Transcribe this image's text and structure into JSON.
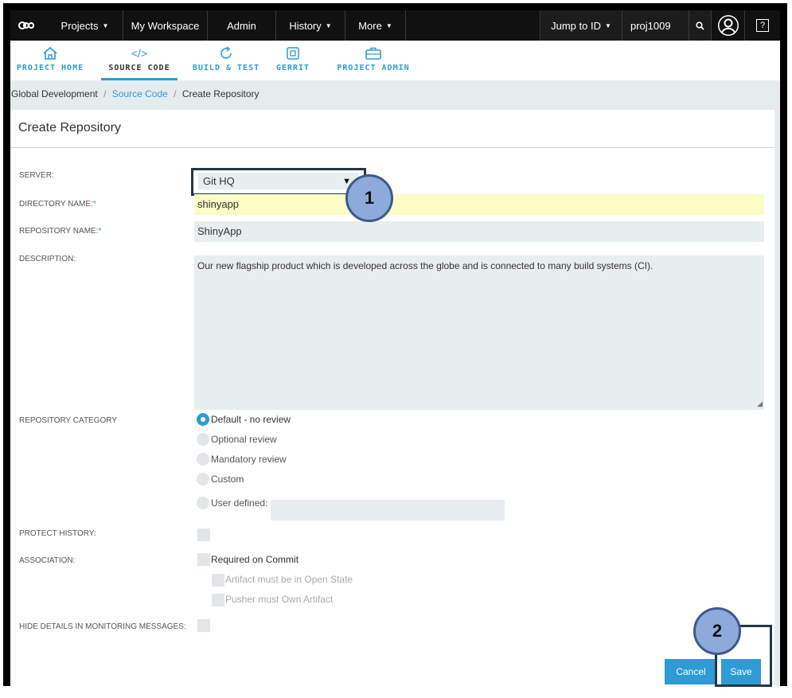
{
  "topnav": {
    "projects": "Projects",
    "workspace": "My Workspace",
    "admin": "Admin",
    "history": "History",
    "more": "More",
    "jump": "Jump to ID",
    "project_id": "proj1009",
    "help": "?"
  },
  "subnav": {
    "tabs": [
      {
        "label": "PROJECT HOME",
        "icon": "home-icon"
      },
      {
        "label": "SOURCE CODE",
        "icon": "code-icon",
        "active": true
      },
      {
        "label": "BUILD & TEST",
        "icon": "refresh-icon"
      },
      {
        "label": "GERRIT",
        "icon": "gerrit-icon"
      },
      {
        "label": "PROJECT ADMIN",
        "icon": "briefcase-icon"
      }
    ]
  },
  "breadcrumb": {
    "root": "Global Development",
    "section": "Source Code",
    "current": "Create Repository",
    "sep": "/"
  },
  "form": {
    "title": "Create Repository",
    "server_label": "SERVER:",
    "server_value": "Git HQ",
    "directory_label": "DIRECTORY NAME:",
    "directory_value": "shinyapp",
    "repo_label": "REPOSITORY NAME:",
    "repo_value": "ShinyApp",
    "description_label": "DESCRIPTION:",
    "description_value": "Our new flagship product which is developed across the globe and is connected to many build systems (CI).",
    "category_label": "REPOSITORY CATEGORY",
    "categories": [
      "Default - no review",
      "Optional review",
      "Mandatory review",
      "Custom",
      "User defined:"
    ],
    "category_selected": "Default - no review",
    "protect_label": "PROTECT HISTORY:",
    "association_label": "ASSOCIATION:",
    "association_options": [
      "Required on Commit",
      "Artifact must be in Open State",
      "Pusher must Own Artifact"
    ],
    "hide_label": "HIDE DETAILS IN MONITORING MESSAGES:",
    "required_mark": "*"
  },
  "buttons": {
    "cancel": "Cancel",
    "save": "Save"
  },
  "callouts": [
    "1",
    "2"
  ],
  "colors": {
    "accent": "#2d9bd6",
    "topnav_bg": "#111111",
    "callout_fill": "#8eaadb",
    "highlight": "#fbfcc6"
  }
}
